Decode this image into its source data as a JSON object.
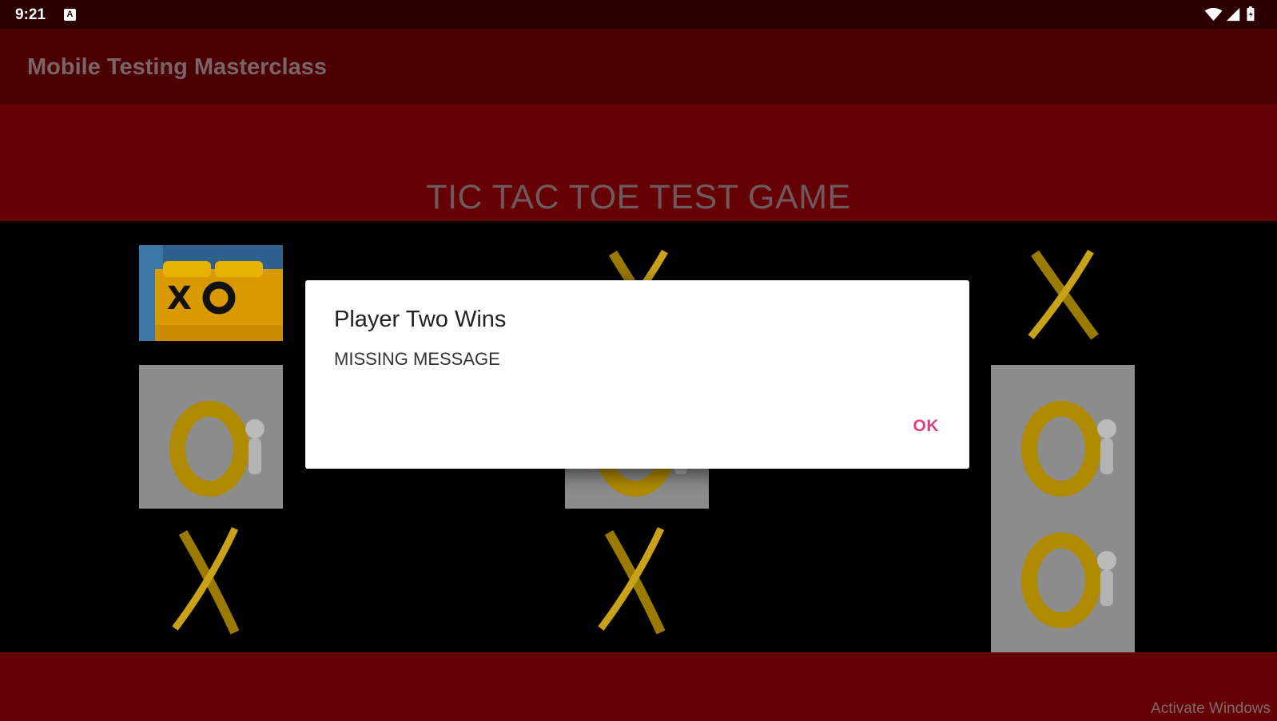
{
  "status": {
    "time": "9:21",
    "notif_icon": "a-icon"
  },
  "appbar": {
    "title": "Mobile Testing Masterclass"
  },
  "game": {
    "title": "TIC TAC TOE TEST GAME"
  },
  "board": {
    "cells": [
      "logo",
      "x",
      "x",
      "o",
      "o",
      "o",
      "x",
      "x",
      "o"
    ]
  },
  "dialog": {
    "title": "Player Two Wins",
    "message": "MISSING MESSAGE",
    "ok_label": "OK"
  },
  "watermark": "Activate Windows",
  "colors": {
    "appbar": "#4a0003",
    "banner": "#650004",
    "accent": "#e0407f"
  }
}
